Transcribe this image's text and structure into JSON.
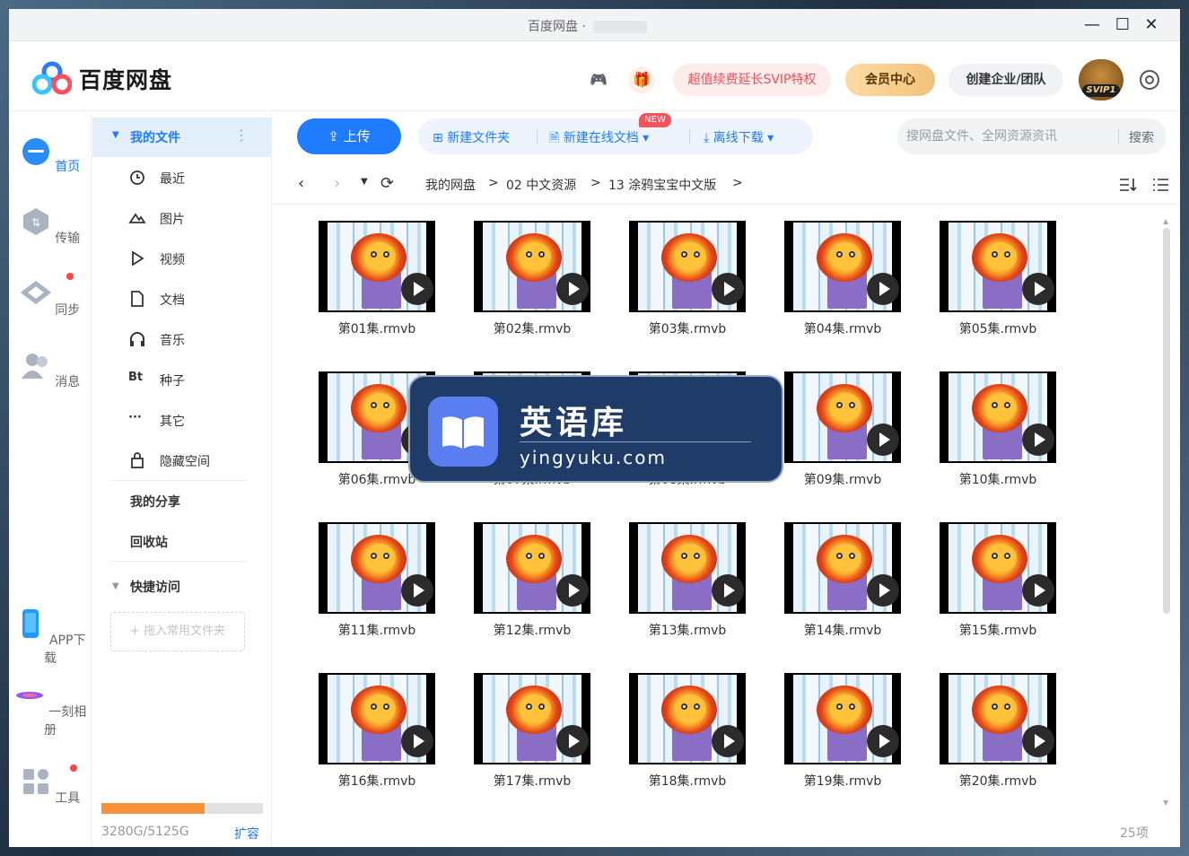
{
  "window": {
    "title": "百度网盘 ·",
    "minimize": "—",
    "maximize": "☐",
    "close": "✕"
  },
  "header": {
    "app_name": "百度网盘",
    "svip_promo": "超值续费延长SVIP特权",
    "member_center": "会员中心",
    "enterprise": "创建企业/团队",
    "svip_level": "SVIP1"
  },
  "leftnav": [
    {
      "label": "首页",
      "icon": "cloud-icon",
      "active": true
    },
    {
      "label": "传输",
      "icon": "transfer-icon",
      "active": false
    },
    {
      "label": "同步",
      "icon": "sync-icon",
      "active": false
    },
    {
      "label": "消息",
      "icon": "message-icon",
      "active": false
    },
    {
      "label": "APP下载",
      "icon": "phone-icon",
      "active": false
    },
    {
      "label": "一刻相册",
      "icon": "album-icon",
      "active": false
    },
    {
      "label": "工具",
      "icon": "tools-icon",
      "active": false
    }
  ],
  "sidebar": {
    "my_files": "我的文件",
    "items": [
      {
        "label": "最近",
        "icon": "clock-icon"
      },
      {
        "label": "图片",
        "icon": "image-icon"
      },
      {
        "label": "视频",
        "icon": "play-icon"
      },
      {
        "label": "文档",
        "icon": "document-icon"
      },
      {
        "label": "音乐",
        "icon": "headphones-icon"
      },
      {
        "label": "种子",
        "icon": "bt-icon"
      },
      {
        "label": "其它",
        "icon": "more-icon"
      },
      {
        "label": "隐藏空间",
        "icon": "lock-icon"
      }
    ],
    "bt_glyph": "Bt",
    "more_glyph": "···",
    "my_share": "我的分享",
    "recycle": "回收站",
    "quick_access": "快捷访问",
    "drop_hint": "+ 拖入常用文件夹",
    "storage_text": "3280G/5125G",
    "storage_used_fraction": 0.64,
    "expand": "扩容"
  },
  "toolbar": {
    "upload": "上传",
    "new_folder": "新建文件夹",
    "new_doc": "新建在线文档",
    "new_badge": "NEW",
    "offline": "离线下载",
    "search_placeholder": "搜网盘文件、全网资源资讯",
    "search_btn": "搜索"
  },
  "breadcrumb": {
    "root": "我的网盘",
    "level1": "02 中文资源",
    "level2": "13 涂鸦宝宝中文版",
    "sep": ">"
  },
  "files": [
    "第01集.rmvb",
    "第02集.rmvb",
    "第03集.rmvb",
    "第04集.rmvb",
    "第05集.rmvb",
    "第06集.rmvb",
    "第07集.rmvb",
    "第08集.rmvb",
    "第09集.rmvb",
    "第10集.rmvb",
    "第11集.rmvb",
    "第12集.rmvb",
    "第13集.rmvb",
    "第14集.rmvb",
    "第15集.rmvb",
    "第16集.rmvb",
    "第17集.rmvb",
    "第18集.rmvb",
    "第19集.rmvb",
    "第20集.rmvb"
  ],
  "item_count": "25项",
  "watermark": {
    "title": "英语库",
    "url": "yingyuku.com"
  }
}
